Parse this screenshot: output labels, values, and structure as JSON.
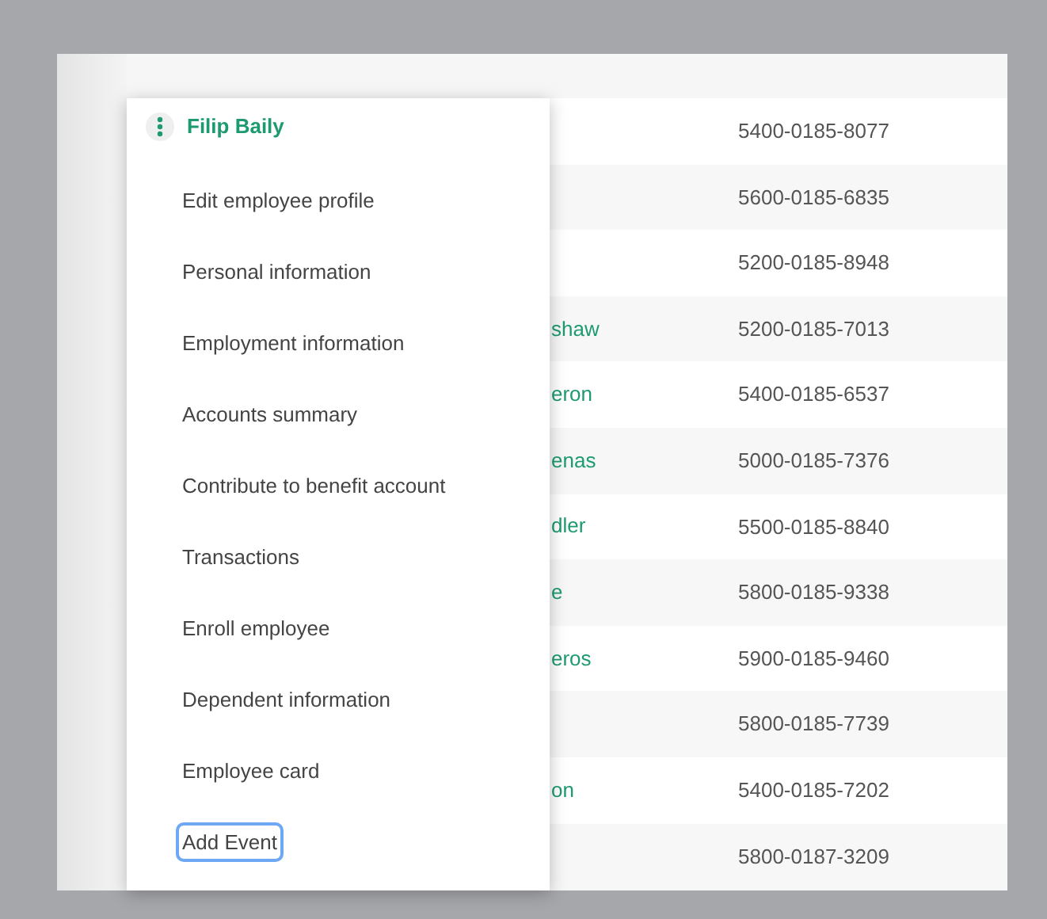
{
  "table": {
    "rows": [
      {
        "account": "5400-0185-8077"
      },
      {
        "account": "5600-0185-6835"
      },
      {
        "account": "5200-0185-8948"
      },
      {
        "name": "shaw",
        "account": "5200-0185-7013"
      },
      {
        "name": "eron",
        "account": "5400-0185-6537"
      },
      {
        "name": "enas",
        "account": "5000-0185-7376"
      },
      {
        "name": "dler",
        "account": "5500-0185-8840"
      },
      {
        "name": "e",
        "account": "5800-0185-9338"
      },
      {
        "name": "eros",
        "account": "5900-0185-9460"
      },
      {
        "account": "5800-0185-7739"
      },
      {
        "name": "on",
        "account": "5400-0185-7202"
      },
      {
        "account": "5800-0187-3209"
      }
    ]
  },
  "menu": {
    "title": "Filip Baily",
    "items": [
      {
        "label": "Edit employee profile",
        "focused": false
      },
      {
        "label": "Personal information",
        "focused": false
      },
      {
        "label": "Employment information",
        "focused": false
      },
      {
        "label": "Accounts summary",
        "focused": false
      },
      {
        "label": "Contribute to benefit account",
        "focused": false
      },
      {
        "label": "Transactions",
        "focused": false
      },
      {
        "label": "Enroll employee",
        "focused": false
      },
      {
        "label": "Dependent information",
        "focused": false
      },
      {
        "label": "Employee card",
        "focused": false
      },
      {
        "label": "Add Event",
        "focused": true
      }
    ]
  }
}
